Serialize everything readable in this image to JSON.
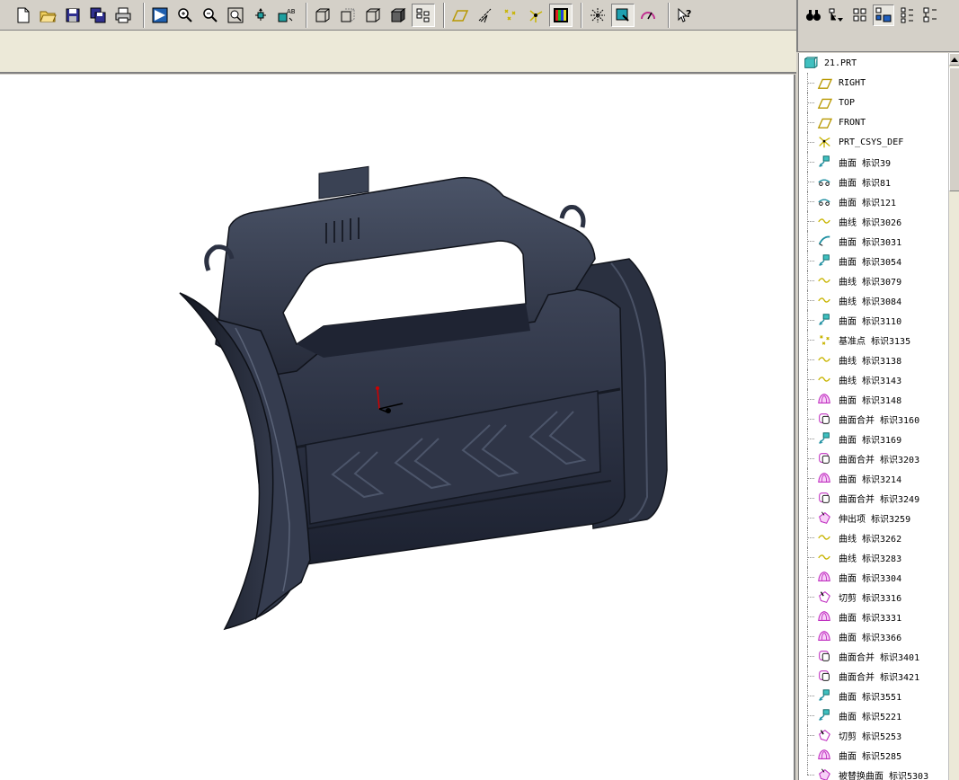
{
  "toolbar": {
    "groups": [
      [
        "new-icon",
        "open-icon",
        "save-icon",
        "save-copy-icon",
        "print-icon"
      ],
      [
        "repaint-icon",
        "zoom-in-icon",
        "zoom-out-icon",
        "refit-icon",
        "orient-icon",
        "saved-views-icon"
      ],
      [
        "wireframe-icon",
        "hidden-line-icon",
        "no-hidden-icon",
        "shading-icon",
        "layers-icon"
      ],
      [
        "datum-plane-icon",
        "datum-axis-icon",
        "datum-point-icon",
        "coord-sys-icon",
        "color-icon"
      ],
      [
        "spin-center-icon",
        "model-tree-icon",
        "analysis-icon"
      ],
      [
        "help-icon"
      ]
    ]
  },
  "side_toolbar": {
    "icons": [
      "find-icon",
      "show-icon",
      "settings-icon",
      "tree-filter-icon",
      "columns-icon",
      "expand-icon"
    ]
  },
  "tree": {
    "root": {
      "label": "21.PRT",
      "icon": "part-icon"
    },
    "items": [
      {
        "label": "RIGHT",
        "icon": "datum-plane-icon"
      },
      {
        "label": "TOP",
        "icon": "datum-plane-icon"
      },
      {
        "label": "FRONT",
        "icon": "datum-plane-icon"
      },
      {
        "label": "PRT_CSYS_DEF",
        "icon": "csys-icon"
      },
      {
        "label": "曲面 标识39",
        "icon": "surface-copy-icon"
      },
      {
        "label": "曲面 标识81",
        "icon": "surface-offset-icon"
      },
      {
        "label": "曲面 标识121",
        "icon": "surface-offset-icon"
      },
      {
        "label": "曲线 标识3026",
        "icon": "curve-icon"
      },
      {
        "label": "曲面 标识3031",
        "icon": "surface-sweep-icon"
      },
      {
        "label": "曲面 标识3054",
        "icon": "surface-copy-icon"
      },
      {
        "label": "曲线 标识3079",
        "icon": "curve-icon"
      },
      {
        "label": "曲线 标识3084",
        "icon": "curve-icon"
      },
      {
        "label": "曲面 标识3110",
        "icon": "surface-copy-icon"
      },
      {
        "label": "基准点 标识3135",
        "icon": "datum-point-icon"
      },
      {
        "label": "曲线 标识3138",
        "icon": "curve-icon"
      },
      {
        "label": "曲线 标识3143",
        "icon": "curve-icon"
      },
      {
        "label": "曲面 标识3148",
        "icon": "boundary-surface-icon"
      },
      {
        "label": "曲面合并 标识3160",
        "icon": "merge-icon"
      },
      {
        "label": "曲面 标识3169",
        "icon": "surface-copy-icon"
      },
      {
        "label": "曲面合并 标识3203",
        "icon": "merge-icon"
      },
      {
        "label": "曲面 标识3214",
        "icon": "boundary-surface-icon"
      },
      {
        "label": "曲面合并 标识3249",
        "icon": "merge-icon"
      },
      {
        "label": "伸出项 标识3259",
        "icon": "protrusion-icon"
      },
      {
        "label": "曲线 标识3262",
        "icon": "curve-icon"
      },
      {
        "label": "曲线 标识3283",
        "icon": "curve-icon"
      },
      {
        "label": "曲面 标识3304",
        "icon": "boundary-surface-icon"
      },
      {
        "label": "切剪 标识3316",
        "icon": "cut-icon"
      },
      {
        "label": "曲面 标识3331",
        "icon": "boundary-surface-icon"
      },
      {
        "label": "曲面 标识3366",
        "icon": "boundary-surface-icon"
      },
      {
        "label": "曲面合并 标识3401",
        "icon": "merge-icon"
      },
      {
        "label": "曲面合并 标识3421",
        "icon": "merge-icon"
      },
      {
        "label": "曲面 标识3551",
        "icon": "surface-copy-icon"
      },
      {
        "label": "曲面 标识5221",
        "icon": "surface-copy-icon"
      },
      {
        "label": "切剪 标识5253",
        "icon": "cut-icon"
      },
      {
        "label": "曲面 标识5285",
        "icon": "boundary-surface-icon"
      },
      {
        "label": "被替换曲面 标识5303",
        "icon": "protrusion-icon"
      }
    ]
  },
  "colors": {
    "model_body": "#2e3445",
    "model_dark": "#1a1e29",
    "model_light": "#4a5266",
    "datum_yellow": "#c8b400",
    "surface_teal": "#1b8ea0",
    "boundary_magenta": "#c030c0"
  }
}
